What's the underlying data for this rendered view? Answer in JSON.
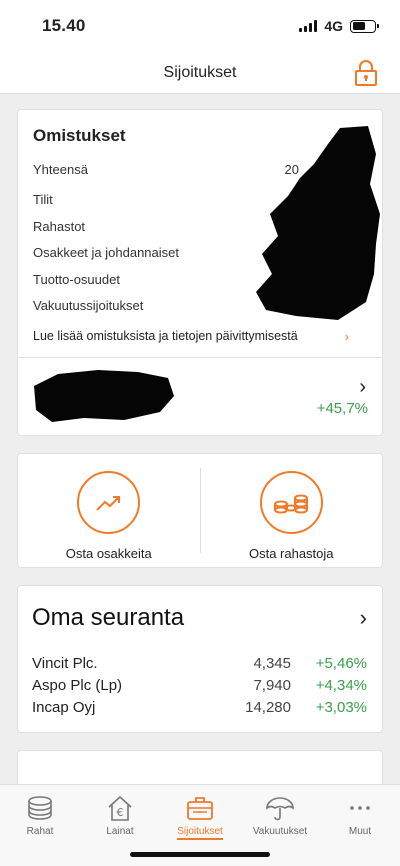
{
  "status_bar": {
    "time": "15.40",
    "network": "4G"
  },
  "header": {
    "title": "Sijoitukset",
    "lock_icon": "lock-icon"
  },
  "holdings": {
    "title": "Omistukset",
    "total_label": "Yhteensä",
    "total_value_partial": "20",
    "rows": [
      "Tilit",
      "Rahastot",
      "Osakkeet ja johdannaiset",
      "Tuotto-osuudet",
      "Vakuutussijoitukset"
    ],
    "read_more": "Lue lisää omistuksista ja tietojen päivittymisestä"
  },
  "account": {
    "change": "+45,7%"
  },
  "buy": {
    "stocks_label": "Osta osakkeita",
    "funds_label": "Osta rahastoja"
  },
  "watchlist": {
    "title": "Oma seuranta",
    "items": [
      {
        "name": "Vincit Plc.",
        "price": "4,345",
        "change": "+5,46%"
      },
      {
        "name": "Aspo Plc (Lp)",
        "price": "7,940",
        "change": "+4,34%"
      },
      {
        "name": "Incap Oyj",
        "price": "14,280",
        "change": "+3,03%"
      }
    ]
  },
  "tabs": [
    {
      "label": "Rahat",
      "icon": "coins-icon"
    },
    {
      "label": "Lainat",
      "icon": "house-euro-icon"
    },
    {
      "label": "Sijoitukset",
      "icon": "briefcase-icon",
      "active": true
    },
    {
      "label": "Vakuutukset",
      "icon": "umbrella-icon"
    },
    {
      "label": "Muut",
      "icon": "more-icon"
    }
  ],
  "colors": {
    "accent": "#f07a29",
    "positive": "#3aa14a"
  }
}
